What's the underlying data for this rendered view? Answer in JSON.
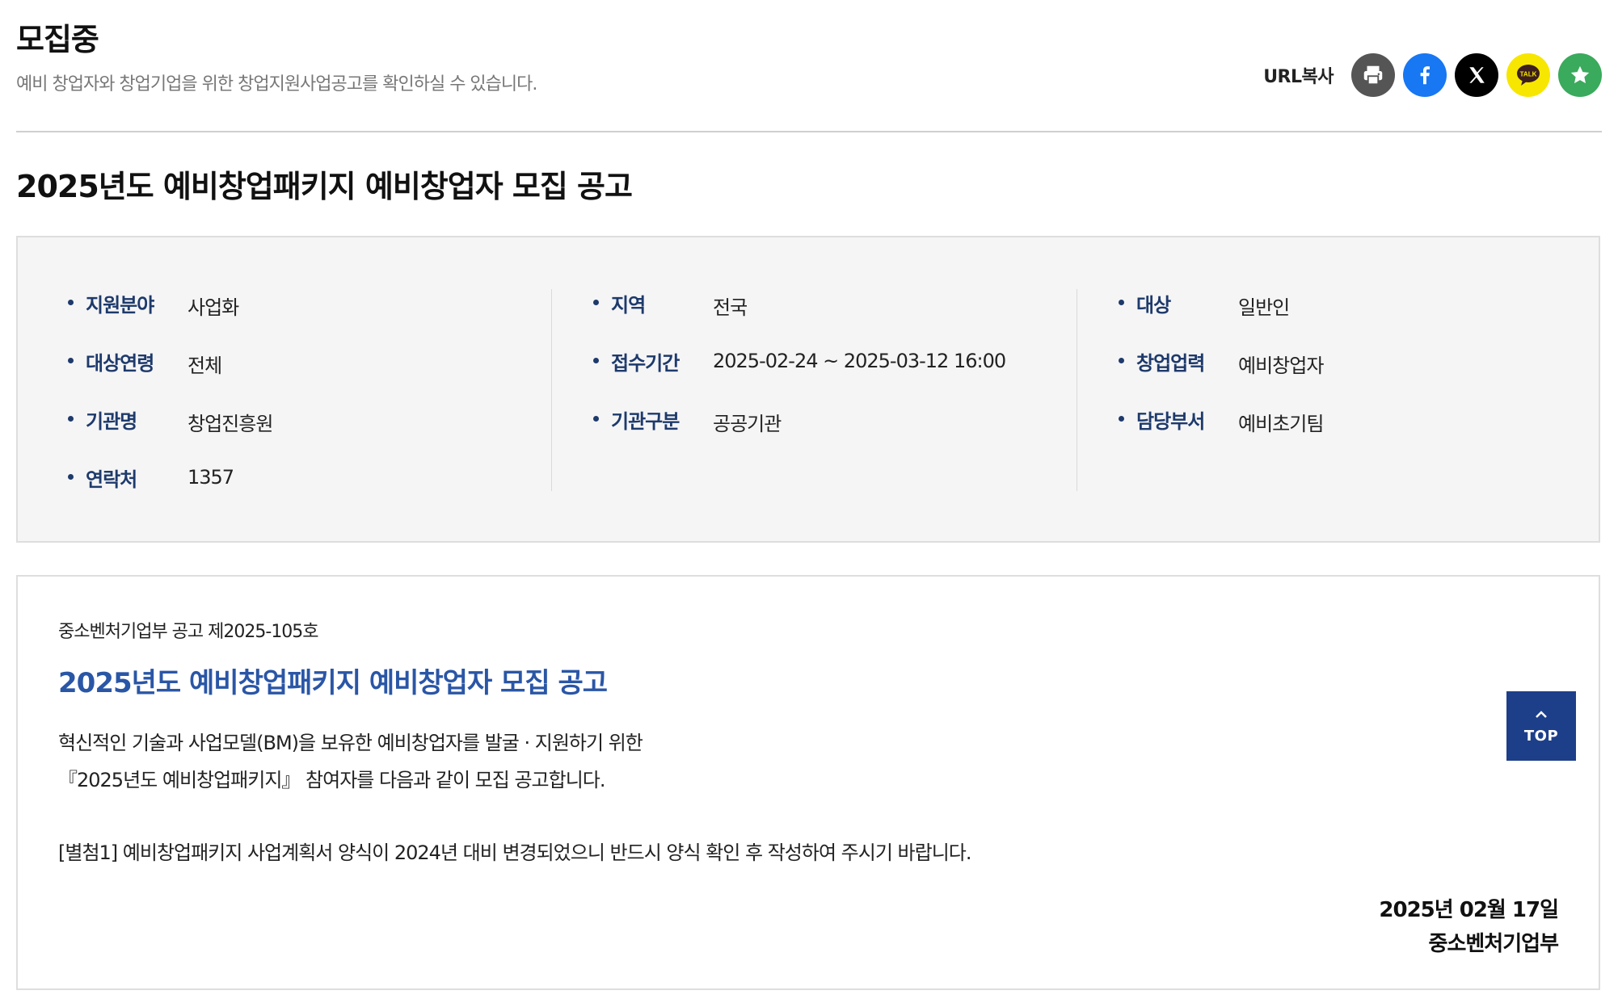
{
  "header": {
    "title": "모집중",
    "description": "예비 창업자와 창업기업을 위한 창업지원사업공고를 확인하실 수 있습니다."
  },
  "share": {
    "url_copy_label": "URL복사",
    "buttons": [
      {
        "name": "print",
        "icon": "printer-icon",
        "color": "#555555"
      },
      {
        "name": "facebook",
        "icon": "facebook-icon",
        "color": "#1877f2"
      },
      {
        "name": "x",
        "icon": "x-icon",
        "color": "#000000"
      },
      {
        "name": "kakaotalk",
        "icon": "kakaotalk-icon",
        "color": "#f7e600"
      },
      {
        "name": "favorite",
        "icon": "star-icon",
        "color": "#3aaa5c"
      }
    ],
    "kakao_icon_text": "TALK"
  },
  "post": {
    "title": "2025년도 예비창업패키지 예비창업자 모집 공고"
  },
  "info": {
    "col1": [
      {
        "label": "지원분야",
        "value": "사업화"
      },
      {
        "label": "대상연령",
        "value": "전체"
      },
      {
        "label": "기관명",
        "value": "창업진흥원"
      },
      {
        "label": "연락처",
        "value": "1357"
      }
    ],
    "col2": [
      {
        "label": "지역",
        "value": "전국"
      },
      {
        "label": "접수기간",
        "value": "2025-02-24 ~ 2025-03-12 16:00"
      },
      {
        "label": "기관구분",
        "value": "공공기관"
      }
    ],
    "col3": [
      {
        "label": "대상",
        "value": "일반인"
      },
      {
        "label": "창업업력",
        "value": "예비창업자"
      },
      {
        "label": "담당부서",
        "value": "예비초기팀"
      }
    ]
  },
  "content": {
    "notice_no": "중소벤처기업부 공고 제2025-105호",
    "title": "2025년도 예비창업패키지 예비창업자 모집 공고",
    "line1": "혁신적인 기술과 사업모델(BM)을 보유한 예비창업자를 발굴 · 지원하기 위한",
    "line2": "『2025년도 예비창업패키지』 참여자를 다음과 같이 모집 공고합니다.",
    "attachment_note": "[별첨1] 예비창업패키지 사업계획서 양식이 2024년 대비 변경되었으니 반드시 양식 확인 후 작성하여 주시기 바랍니다.",
    "date": "2025년 02월 17일",
    "organization": "중소벤처기업부"
  },
  "top_button": {
    "label": "TOP"
  }
}
